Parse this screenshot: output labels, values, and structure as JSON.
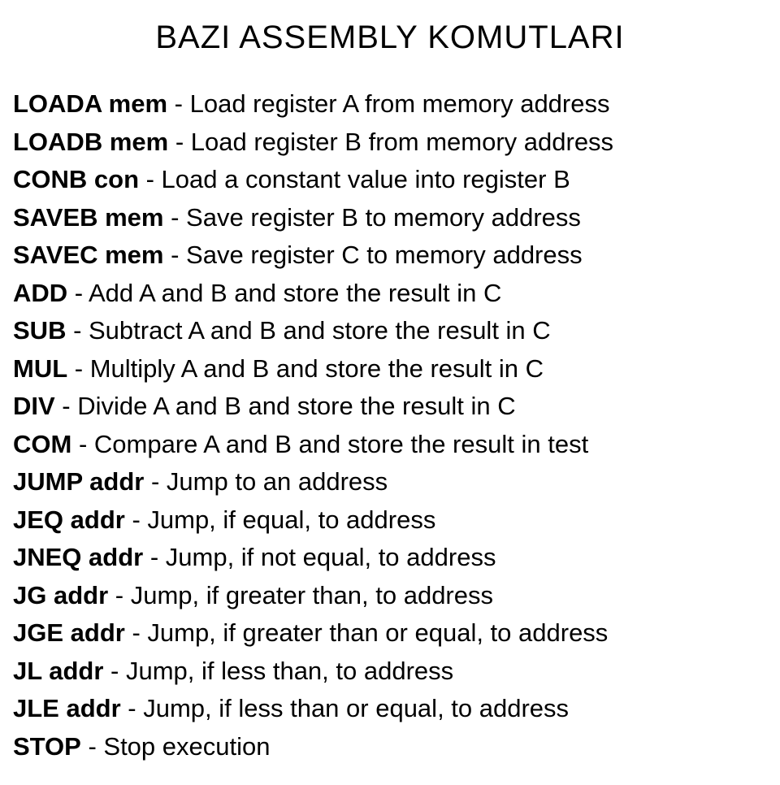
{
  "title": "BAZI ASSEMBLY KOMUTLARI",
  "instructions": [
    {
      "mnemonic": "LOADA mem",
      "desc": " - Load register A from memory address"
    },
    {
      "mnemonic": "LOADB mem",
      "desc": " - Load register B from memory address"
    },
    {
      "mnemonic": "CONB con",
      "desc": " - Load a constant value into register B"
    },
    {
      "mnemonic": "SAVEB mem",
      "desc": " - Save register B to memory address"
    },
    {
      "mnemonic": "SAVEC mem",
      "desc": " - Save register C to memory address"
    },
    {
      "mnemonic": "ADD",
      "desc": " - Add A and B and store the result in C"
    },
    {
      "mnemonic": "SUB",
      "desc": " - Subtract A and B and store the result in C"
    },
    {
      "mnemonic": "MUL",
      "desc": " - Multiply A and B and store the result in C"
    },
    {
      "mnemonic": "DIV",
      "desc": " - Divide A and B and store the result in C"
    },
    {
      "mnemonic": "COM",
      "desc": " - Compare A and B and store the result in test"
    },
    {
      "mnemonic": "JUMP addr",
      "desc": " - Jump to an address"
    },
    {
      "mnemonic": "JEQ addr",
      "desc": " - Jump, if equal, to address"
    },
    {
      "mnemonic": "JNEQ addr",
      "desc": " - Jump, if not equal, to address"
    },
    {
      "mnemonic": "JG addr",
      "desc": " - Jump, if greater than, to address"
    },
    {
      "mnemonic": "JGE addr",
      "desc": " - Jump, if greater than or equal, to address"
    },
    {
      "mnemonic": "JL addr",
      "desc": " - Jump, if less than, to address"
    },
    {
      "mnemonic": "JLE addr",
      "desc": " - Jump, if less than or equal, to address"
    },
    {
      "mnemonic": "STOP",
      "desc": " - Stop execution"
    }
  ]
}
